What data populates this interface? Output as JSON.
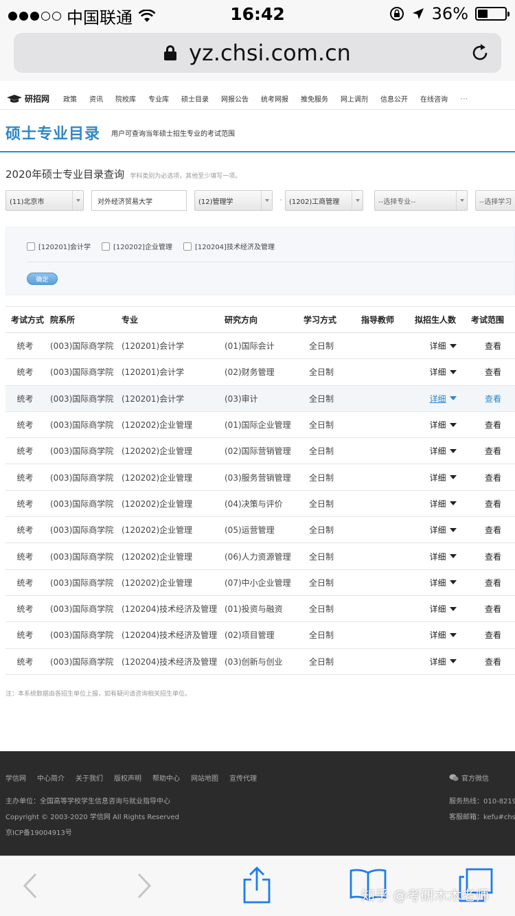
{
  "statusbar": {
    "carrier": "中国联通",
    "time": "16:42",
    "battery_percent": "36%",
    "battery_level": 0.36
  },
  "browser": {
    "url": "yz.chsi.com.cn"
  },
  "site": {
    "logo_text": "研招网",
    "nav": [
      "政策",
      "资讯",
      "院校库",
      "专业库",
      "硕士目录",
      "网报公告",
      "统考网报",
      "推免服务",
      "网上调剂",
      "信息公开",
      "在线咨询",
      "···"
    ]
  },
  "page": {
    "title": "硕士专业目录",
    "subtitle": "用户可查询当年硕士招生专业的考试范围",
    "query_title": "2020年硕士专业目录查询",
    "query_hint": "学科类别为必选项，其他至少填写一项。"
  },
  "filters": {
    "province": "(11)北京市",
    "school": "对外经济贸易大学",
    "category": "(12)管理学",
    "sep": "-",
    "discipline": "(1202)工商管理",
    "major": "--选择专业--",
    "study_mode": "--选择学习"
  },
  "checkboxes": [
    "[120201]会计学",
    "[120202]企业管理",
    "[120204]技术经济及管理"
  ],
  "confirm_label": "确定",
  "table": {
    "headers": [
      "考试方式",
      "院系所",
      "专业",
      "研究方向",
      "学习方式",
      "指导教师",
      "拟招生人数",
      "考试范围"
    ],
    "detail_label": "详细",
    "view_label": "查看",
    "rows": [
      {
        "mode": "统考",
        "dept": "(003)国际商学院",
        "major": "(120201)会计学",
        "direction": "(01)国际会计",
        "study": "全日制"
      },
      {
        "mode": "统考",
        "dept": "(003)国际商学院",
        "major": "(120201)会计学",
        "direction": "(02)财务管理",
        "study": "全日制"
      },
      {
        "mode": "统考",
        "dept": "(003)国际商学院",
        "major": "(120201)会计学",
        "direction": "(03)审计",
        "study": "全日制"
      },
      {
        "mode": "统考",
        "dept": "(003)国际商学院",
        "major": "(120202)企业管理",
        "direction": "(01)国际企业管理",
        "study": "全日制"
      },
      {
        "mode": "统考",
        "dept": "(003)国际商学院",
        "major": "(120202)企业管理",
        "direction": "(02)国际营销管理",
        "study": "全日制"
      },
      {
        "mode": "统考",
        "dept": "(003)国际商学院",
        "major": "(120202)企业管理",
        "direction": "(03)服务营销管理",
        "study": "全日制"
      },
      {
        "mode": "统考",
        "dept": "(003)国际商学院",
        "major": "(120202)企业管理",
        "direction": "(04)决策与评价",
        "study": "全日制"
      },
      {
        "mode": "统考",
        "dept": "(003)国际商学院",
        "major": "(120202)企业管理",
        "direction": "(05)运营管理",
        "study": "全日制"
      },
      {
        "mode": "统考",
        "dept": "(003)国际商学院",
        "major": "(120202)企业管理",
        "direction": "(06)人力资源管理",
        "study": "全日制"
      },
      {
        "mode": "统考",
        "dept": "(003)国际商学院",
        "major": "(120202)企业管理",
        "direction": "(07)中小企业管理",
        "study": "全日制"
      },
      {
        "mode": "统考",
        "dept": "(003)国际商学院",
        "major": "(120204)技术经济及管理",
        "direction": "(01)投资与融资",
        "study": "全日制"
      },
      {
        "mode": "统考",
        "dept": "(003)国际商学院",
        "major": "(120204)技术经济及管理",
        "direction": "(02)项目管理",
        "study": "全日制"
      },
      {
        "mode": "统考",
        "dept": "(003)国际商学院",
        "major": "(120204)技术经济及管理",
        "direction": "(03)创新与创业",
        "study": "全日制"
      }
    ]
  },
  "note": "注：本系统数据由各招生单位上报，如有疑问请咨询相关招生单位。",
  "footer": {
    "links": [
      "学信网",
      "中心简介",
      "关于我们",
      "版权声明",
      "帮助中心",
      "网站地图",
      "宣传代理"
    ],
    "wechat": "官方微信",
    "sponsor": "主办单位：全国高等学校学生信息咨询与就业指导中心",
    "copyright": "Copyright © 2003-2020 学信网 All Rights Reserved",
    "icp": "京ICP备19004913号",
    "hotline": "服务热线：010-8219",
    "email": "客服邮箱：kefu#chs"
  },
  "watermark": "知乎 @考研木木老师"
}
